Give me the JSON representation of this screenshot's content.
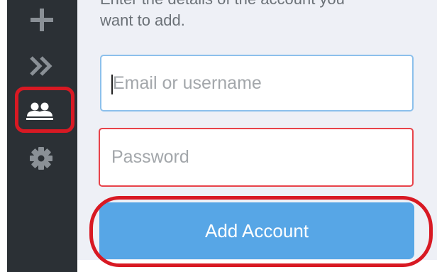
{
  "sidebar": {
    "items": [
      {
        "icon": "plus-icon",
        "label": "Add"
      },
      {
        "icon": "double-chevron-right-icon",
        "label": "Expand"
      },
      {
        "icon": "accounts-icon",
        "label": "Accounts",
        "highlighted": true
      },
      {
        "icon": "gear-icon",
        "label": "Settings"
      }
    ]
  },
  "form": {
    "intro_line1": "Enter the details of the account you",
    "intro_line2": "want to add.",
    "email_placeholder": "Email or username",
    "password_placeholder": "Password",
    "submit_label": "Add Account"
  },
  "colors": {
    "sidebar_bg": "#2b3035",
    "panel_bg": "#eef0f6",
    "accent_blue": "#57a6e6",
    "focus_border": "#8cc0ec",
    "error_border": "#e8434a",
    "annotation_red": "#d81923"
  }
}
